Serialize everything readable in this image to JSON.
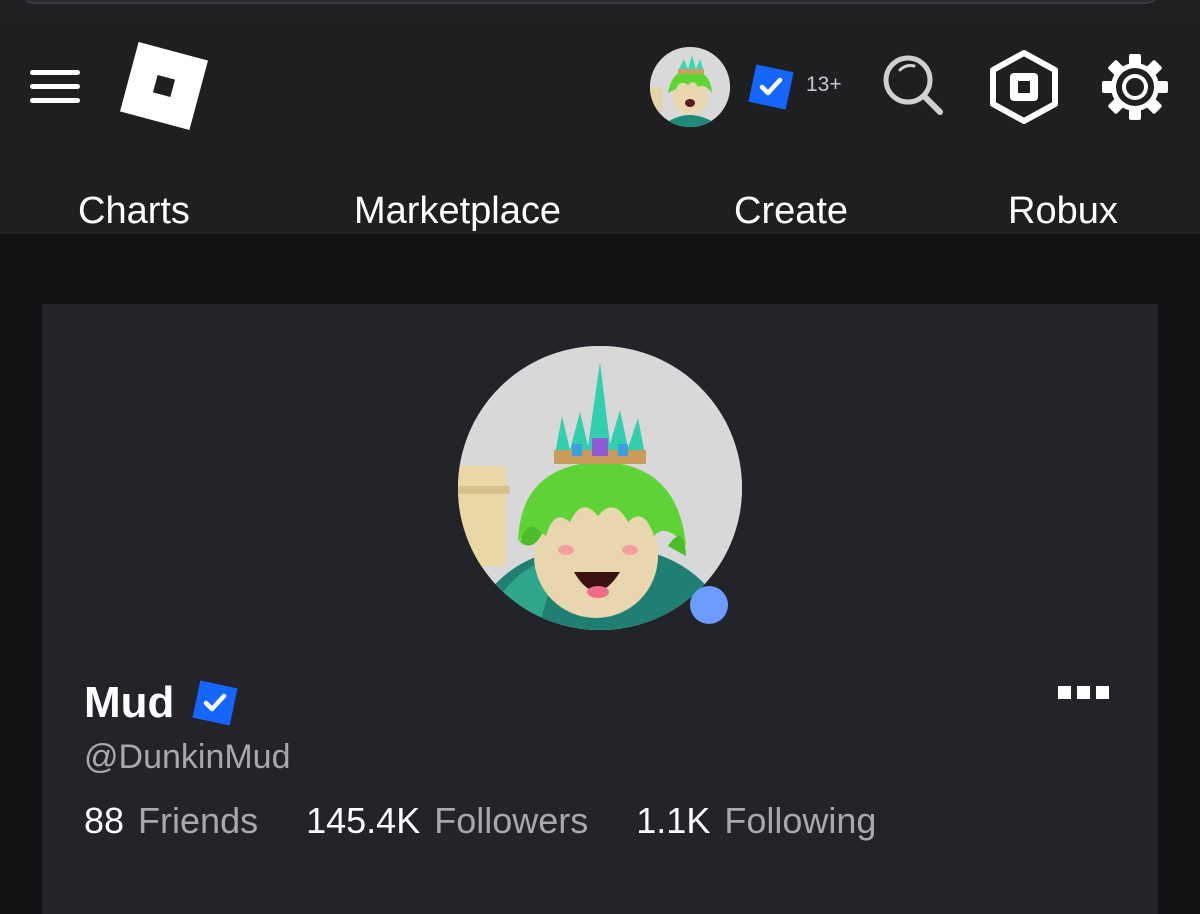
{
  "header": {
    "age_rating": "13+",
    "nav": [
      {
        "label": "Charts"
      },
      {
        "label": "Marketplace"
      },
      {
        "label": "Create"
      },
      {
        "label": "Robux"
      }
    ]
  },
  "profile": {
    "display_name": "Mud",
    "username": "@DunkinMud",
    "verified": true,
    "online": true,
    "stats": [
      {
        "value": "88",
        "label": "Friends"
      },
      {
        "value": "145.4K",
        "label": "Followers"
      },
      {
        "value": "1.1K",
        "label": "Following"
      }
    ]
  },
  "colors": {
    "background": "#111214",
    "header": "#1d1f21",
    "card": "#232429",
    "verified_blue": "#1565ff",
    "presence": "#6d9cff",
    "muted_text": "#a7a9ae"
  },
  "icons": [
    "menu-icon",
    "roblox-logo-icon",
    "verified-icon",
    "search-icon",
    "robux-icon",
    "gear-icon",
    "more-icon"
  ]
}
